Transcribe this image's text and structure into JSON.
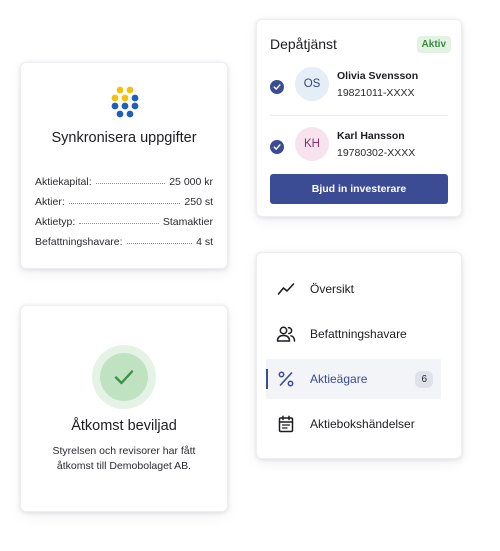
{
  "sync_card": {
    "title": "Synkronisera uppgifter",
    "rows": [
      {
        "label": "Aktiekapital:",
        "value": "25 000 kr"
      },
      {
        "label": "Aktier:",
        "value": "250 st"
      },
      {
        "label": "Aktietyp:",
        "value": "Stamaktier"
      },
      {
        "label": "Befattningshavare:",
        "value": "4 st"
      }
    ],
    "logo_colors": {
      "yellow": "#f4c20d",
      "blue": "#1f5fb8"
    }
  },
  "access_card": {
    "icon": "checkmark-icon",
    "title": "Åtkomst beviljad",
    "description": "Styrelsen och revisorer har fått åtkomst till Demobolaget AB."
  },
  "depot_card": {
    "title": "Depåtjänst",
    "status": "Aktiv",
    "investors": [
      {
        "initials": "OS",
        "name": "Olivia Svensson",
        "id": "19821011-XXXX",
        "checked": true
      },
      {
        "initials": "KH",
        "name": "Karl Hansson",
        "id": "19780302-XXXX",
        "checked": true
      }
    ],
    "invite_label": "Bjud in investerare"
  },
  "nav": {
    "items": [
      {
        "icon": "trend-line-icon",
        "label": "Översikt"
      },
      {
        "icon": "people-icon",
        "label": "Befattningshavare"
      },
      {
        "icon": "percent-icon",
        "label": "Aktieägare",
        "count": "6",
        "active": true
      },
      {
        "icon": "calendar-icon",
        "label": "Aktiebokshändelser"
      }
    ]
  },
  "colors": {
    "primary": "#3b4b94",
    "success": "#3b8a3f",
    "success_bg": "#e3f3e3"
  }
}
